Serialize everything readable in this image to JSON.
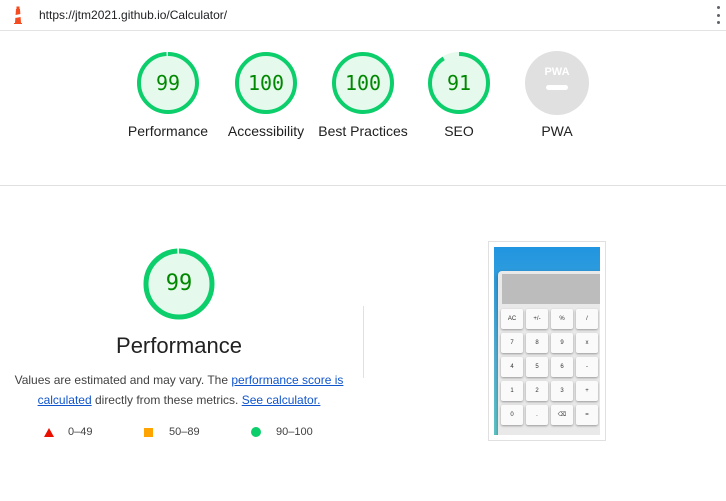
{
  "browser": {
    "url": "https://jtm2021.github.io/Calculator/",
    "logo_icon": "lighthouse-icon",
    "menu_icon": "kebab-menu-icon"
  },
  "summary": {
    "gauges": [
      {
        "score": "99",
        "label": "Performance",
        "fraction": 0.99,
        "color": "#0cce6b"
      },
      {
        "score": "100",
        "label": "Accessibility",
        "fraction": 1.0,
        "color": "#0cce6b"
      },
      {
        "score": "100",
        "label": "Best Practices",
        "fraction": 1.0,
        "color": "#0cce6b"
      },
      {
        "score": "91",
        "label": "SEO",
        "fraction": 0.91,
        "color": "#0cce6b"
      },
      {
        "badge": "PWA",
        "label": "PWA",
        "color": "#e0e0e0"
      }
    ]
  },
  "performance": {
    "score": "99",
    "fraction": 0.99,
    "title": "Performance",
    "desc_prefix": "Values are estimated and may vary. The ",
    "desc_link1": "performance score is calculated",
    "desc_middle": " directly from these metrics. ",
    "desc_link2": "See calculator."
  },
  "legend": {
    "fail": "0–49",
    "average": "50–89",
    "pass": "90–100",
    "colors": {
      "fail": "#eb0f00",
      "average": "#ffa400",
      "pass": "#0cce6b"
    }
  },
  "thumbnail": {
    "keys": [
      "AC",
      "+/-",
      "%",
      "/",
      "7",
      "8",
      "9",
      "x",
      "4",
      "5",
      "6",
      "-",
      "1",
      "2",
      "3",
      "+",
      "0",
      ".",
      "⌫",
      "="
    ]
  },
  "colors": {
    "pass_text": "#008800",
    "pass_fill": "#e5f9ed",
    "pass_ring": "#0cce6b"
  }
}
